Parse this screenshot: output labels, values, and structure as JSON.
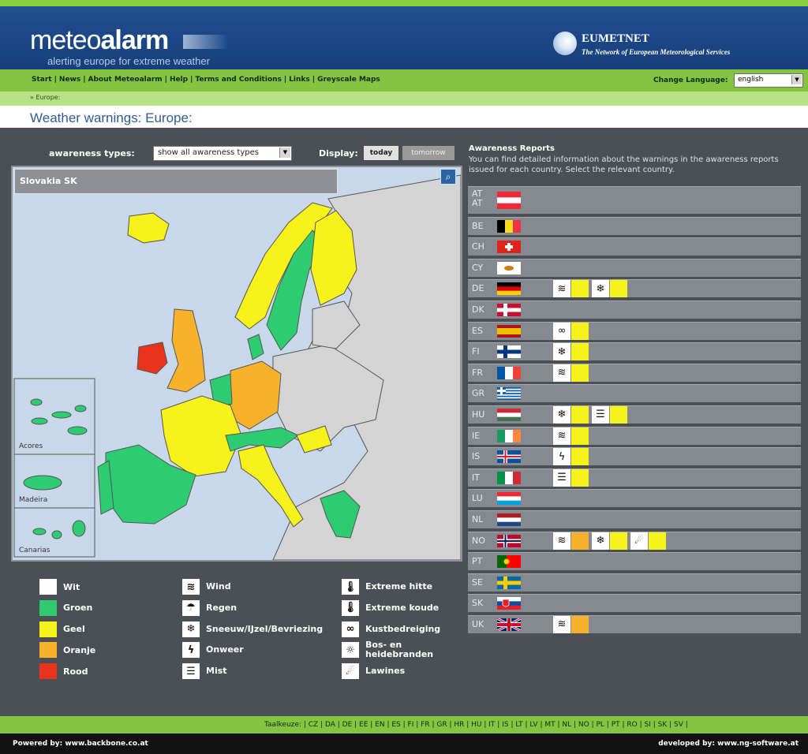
{
  "brand": {
    "logo_light": "meteo",
    "logo_bold": "alarm",
    "tagline": "alerting europe for extreme weather",
    "partner_name": "EUMETNET",
    "partner_subtitle": "The Network of European Meteorological Services"
  },
  "nav": {
    "links": [
      "Start",
      "News",
      "About Meteoalarm",
      "Help",
      "Terms and Conditions",
      "Links",
      "Greyscale Maps"
    ],
    "language_label": "Change Language:",
    "language_value": "english"
  },
  "breadcrumb": "» Europe:",
  "page_title": "Weather warnings: Europe:",
  "controls": {
    "awareness_label": "awareness types:",
    "awareness_value": "show all awareness types",
    "display_label": "Display:",
    "today_label": "today",
    "tomorrow_label": "tomorrow"
  },
  "map": {
    "selected_country": "Slovakia SK",
    "inset_labels": [
      "Acores",
      "Madeira",
      "Canarias"
    ]
  },
  "legend": {
    "levels": [
      {
        "label": "Wit",
        "color": "#ffffff"
      },
      {
        "label": "Groen",
        "color": "#2ecc71"
      },
      {
        "label": "Geel",
        "color": "#f7f21a"
      },
      {
        "label": "Oranje",
        "color": "#f7b12a"
      },
      {
        "label": "Rood",
        "color": "#e8341c"
      }
    ],
    "types_col1": [
      {
        "label": "Wind",
        "icon": "wind-icon"
      },
      {
        "label": "Regen",
        "icon": "rain-icon"
      },
      {
        "label": "Sneeuw/IJzel/Bevriezing",
        "icon": "snow-icon"
      },
      {
        "label": "Onweer",
        "icon": "thunderstorm-icon"
      },
      {
        "label": "Mist",
        "icon": "fog-icon"
      }
    ],
    "types_col2": [
      {
        "label": "Extreme hitte",
        "icon": "heat-thermometer-icon"
      },
      {
        "label": "Extreme koude",
        "icon": "cold-thermometer-icon"
      },
      {
        "label": "Kustbedreiging",
        "icon": "coastal-icon"
      },
      {
        "label": "Bos- en heidebranden",
        "icon": "forest-fire-icon"
      },
      {
        "label": "Lawines",
        "icon": "avalanche-icon"
      }
    ]
  },
  "reports": {
    "title": "Awareness Reports",
    "description": "You can find detailed information about the warnings in the awareness reports issued for each country. Select the relevant country.",
    "countries": [
      {
        "code": "AT",
        "code2": "AT",
        "flag": "at",
        "warnings": []
      },
      {
        "code": "BE",
        "flag": "be",
        "warnings": []
      },
      {
        "code": "CH",
        "flag": "ch",
        "warnings": []
      },
      {
        "code": "CY",
        "flag": "cy",
        "warnings": []
      },
      {
        "code": "DE",
        "flag": "de",
        "warnings": [
          {
            "icon": "wind-icon",
            "level": "#f7f21a"
          },
          {
            "icon": "snow-icon",
            "level": "#f7f21a"
          }
        ]
      },
      {
        "code": "DK",
        "flag": "dk",
        "warnings": []
      },
      {
        "code": "ES",
        "flag": "es",
        "warnings": [
          {
            "icon": "coastal-icon",
            "level": "#f7f21a"
          }
        ]
      },
      {
        "code": "FI",
        "flag": "fi",
        "warnings": [
          {
            "icon": "snow-icon",
            "level": "#f7f21a"
          }
        ]
      },
      {
        "code": "FR",
        "flag": "fr",
        "warnings": [
          {
            "icon": "wind-icon",
            "level": "#f7f21a"
          }
        ]
      },
      {
        "code": "GR",
        "flag": "gr",
        "warnings": []
      },
      {
        "code": "HU",
        "flag": "hu",
        "warnings": [
          {
            "icon": "snow-icon",
            "level": "#f7f21a"
          },
          {
            "icon": "fog-icon",
            "level": "#f7f21a"
          }
        ]
      },
      {
        "code": "IE",
        "flag": "ie",
        "warnings": [
          {
            "icon": "wind-icon",
            "level": "#f7f21a"
          }
        ]
      },
      {
        "code": "IS",
        "flag": "is",
        "warnings": [
          {
            "icon": "thunderstorm-icon",
            "level": "#f7f21a"
          }
        ]
      },
      {
        "code": "IT",
        "flag": "it",
        "warnings": [
          {
            "icon": "fog-icon",
            "level": "#f7f21a"
          }
        ]
      },
      {
        "code": "LU",
        "flag": "lu",
        "warnings": []
      },
      {
        "code": "NL",
        "flag": "nl",
        "warnings": []
      },
      {
        "code": "NO",
        "flag": "no",
        "warnings": [
          {
            "icon": "wind-icon",
            "level": "#f7b12a"
          },
          {
            "icon": "snow-icon",
            "level": "#f7f21a"
          },
          {
            "icon": "avalanche-icon",
            "level": "#f7f21a"
          }
        ]
      },
      {
        "code": "PT",
        "flag": "pt",
        "warnings": []
      },
      {
        "code": "SE",
        "flag": "se",
        "warnings": []
      },
      {
        "code": "SK",
        "flag": "sk",
        "warnings": []
      },
      {
        "code": "UK",
        "flag": "uk",
        "warnings": [
          {
            "icon": "wind-icon",
            "level": "#f7b12a"
          }
        ]
      }
    ]
  },
  "language_bar": {
    "label": "Taalkeuze:",
    "languages": [
      "CZ",
      "DA",
      "DE",
      "EE",
      "EN",
      "ES",
      "FI",
      "FR",
      "GR",
      "HR",
      "HU",
      "IT",
      "IS",
      "LT",
      "LV",
      "MT",
      "NL",
      "NO",
      "PL",
      "PT",
      "RO",
      "SI",
      "SK",
      "SV"
    ]
  },
  "footer": {
    "powered_by": "Powered by: www.backbone.co.at",
    "developed_by": "developed by: www.ng-software.at"
  }
}
